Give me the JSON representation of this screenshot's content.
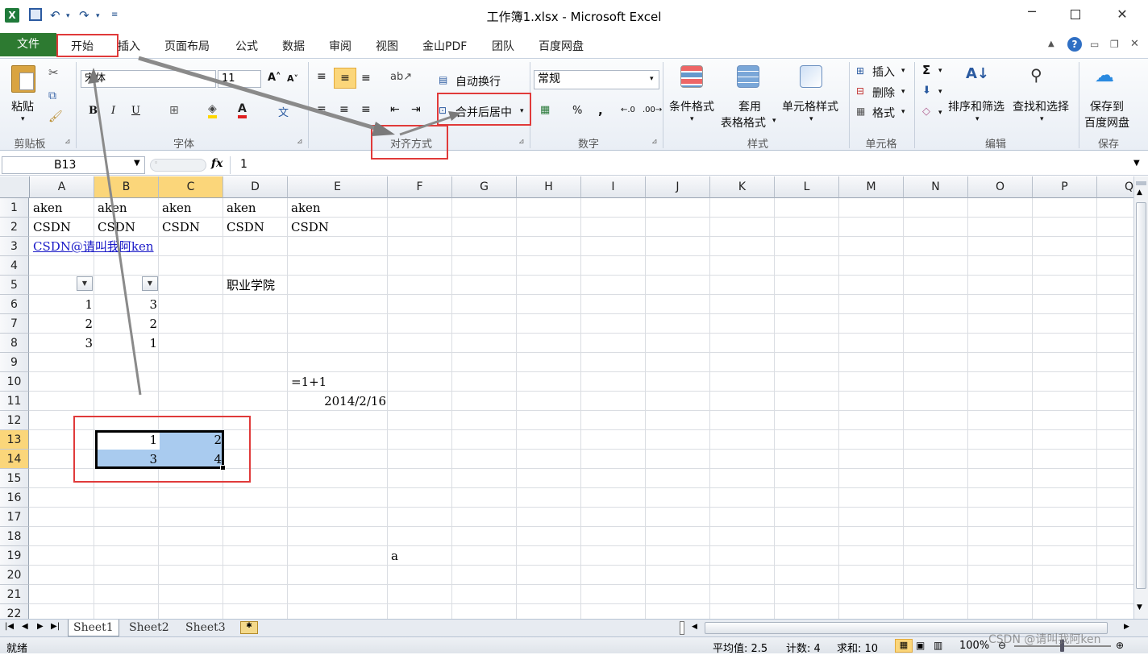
{
  "window": {
    "title": "工作簿1.xlsx - Microsoft Excel"
  },
  "menu": {
    "file": "文件",
    "tabs": [
      "开始",
      "插入",
      "页面布局",
      "公式",
      "数据",
      "审阅",
      "视图",
      "金山PDF",
      "团队",
      "百度网盘"
    ]
  },
  "ribbon": {
    "clipboard": {
      "paste": "粘贴",
      "label": "剪贴板"
    },
    "font": {
      "name": "宋体",
      "size": "11",
      "label": "字体",
      "bold": "B",
      "italic": "I",
      "underline": "U"
    },
    "alignment": {
      "wrap": "自动换行",
      "merge": "合并后居中",
      "label": "对齐方式"
    },
    "number": {
      "format": "常规",
      "percent": "%",
      "comma": ",",
      "label": "数字"
    },
    "styles": {
      "conditional": "条件格式",
      "table_line1": "套用",
      "table_line2": "表格格式",
      "cell_styles": "单元格样式",
      "label": "样式"
    },
    "cells": {
      "insert": "插入",
      "delete": "删除",
      "format": "格式",
      "label": "单元格"
    },
    "editing": {
      "sort": "排序和筛选",
      "find": "查找和选择",
      "label": "编辑"
    },
    "save": {
      "line1": "保存到",
      "line2": "百度网盘",
      "label": "保存"
    }
  },
  "formula": {
    "namebox": "B13",
    "fx": "fx",
    "value": "1"
  },
  "columns": [
    "A",
    "B",
    "C",
    "D",
    "E",
    "F",
    "G",
    "H",
    "I",
    "J",
    "K",
    "L",
    "M",
    "N",
    "O",
    "P",
    "Q"
  ],
  "rows": [
    "1",
    "2",
    "3",
    "4",
    "5",
    "6",
    "7",
    "8",
    "9",
    "10",
    "11",
    "12",
    "13",
    "14",
    "15",
    "16",
    "17",
    "18",
    "19",
    "20",
    "21",
    "22"
  ],
  "cells": {
    "A1": "aken",
    "B1": "aken",
    "C1": "aken",
    "D1": "aken",
    "E1": "aken",
    "A2": "CSDN",
    "B2": "CSDN",
    "C2": "CSDN",
    "D2": "CSDN",
    "E2": "CSDN",
    "A3": "CSDN@请叫我阿ken",
    "D5": "职业学院",
    "A6": "1",
    "B6": "3",
    "A7": "2",
    "B7": "2",
    "A8": "3",
    "B8": "1",
    "E10": "=1+1",
    "E11": "2014/2/16",
    "B13": "1",
    "C13": "2",
    "B14": "3",
    "C14": "4",
    "F19": "a"
  },
  "sheets": [
    "Sheet1",
    "Sheet2",
    "Sheet3"
  ],
  "status": {
    "ready": "就绪",
    "average": "平均值: 2.5",
    "count": "计数: 4",
    "sum": "求和: 10",
    "zoom": "100%"
  },
  "watermark": "CSDN @请叫我阿ken"
}
